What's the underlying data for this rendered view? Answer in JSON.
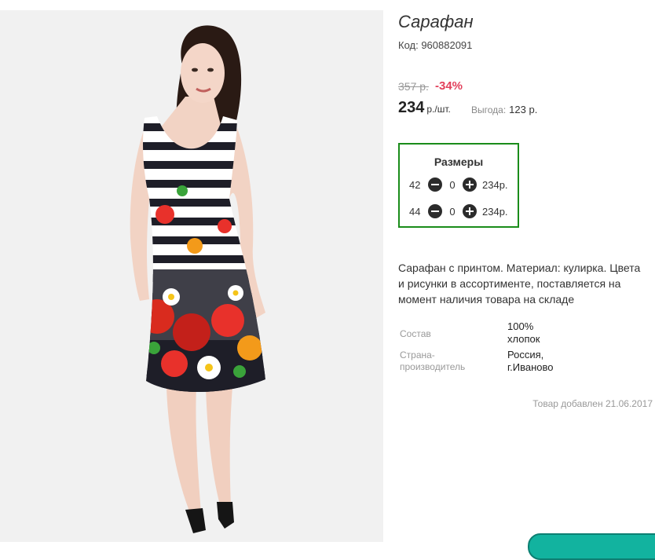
{
  "product": {
    "title": "Сарафан",
    "code": "Код: 960882091",
    "old_price": "357 р.",
    "discount": "-34%",
    "price": "234",
    "price_unit": "р./шт.",
    "benefit_label": "Выгода:",
    "benefit_value": "123 р."
  },
  "sizes": {
    "title": "Размеры",
    "rows": [
      {
        "size": "42",
        "qty": "0",
        "price": "234р."
      },
      {
        "size": "44",
        "qty": "0",
        "price": "234р."
      }
    ]
  },
  "description": "Сарафан с принтом. Материал: кулирка. Цвета и рисунки в ассортименте, поставляется на момент наличия товара на складе",
  "attributes": [
    {
      "label": "Состав",
      "value": "100% хлопок"
    },
    {
      "label": "Страна-производитель",
      "value": "Россия, г.Иваново"
    }
  ],
  "added": "Товар добавлен 21.06.2017",
  "colors": {
    "accent_green": "#1a8c1a",
    "discount_red": "#e2405b",
    "teal": "#12b39f"
  }
}
